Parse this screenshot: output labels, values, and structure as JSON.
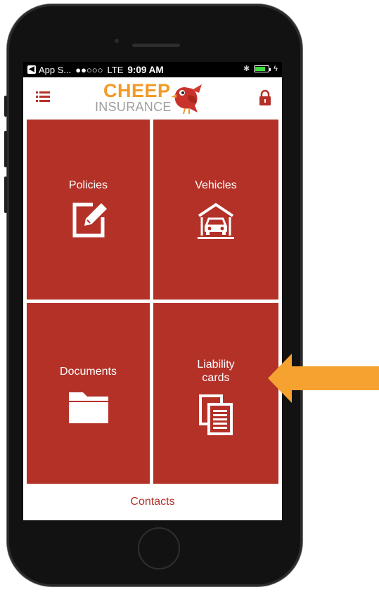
{
  "status_bar": {
    "back_app": "App S...",
    "signal": "●●○○○",
    "network": "LTE",
    "time": "9:09 AM",
    "bluetooth": "✱",
    "battery_level": 0.75,
    "charging": "ϟ"
  },
  "header": {
    "logo_top": "CHEEP",
    "logo_bottom": "INSURANCE",
    "menu_icon": "list-icon",
    "lock_icon": "lock-icon"
  },
  "tiles": [
    {
      "label": "Policies",
      "icon": "edit-icon"
    },
    {
      "label": "Vehicles",
      "icon": "garage-car-icon"
    },
    {
      "label": "Documents",
      "icon": "folder-icon"
    },
    {
      "label": "Liability\ncards",
      "icon": "copy-documents-icon"
    }
  ],
  "footer": {
    "contacts": "Contacts"
  },
  "colors": {
    "brand_red": "#b43128",
    "logo_orange": "#f39a27",
    "arrow_orange": "#f5a230"
  }
}
